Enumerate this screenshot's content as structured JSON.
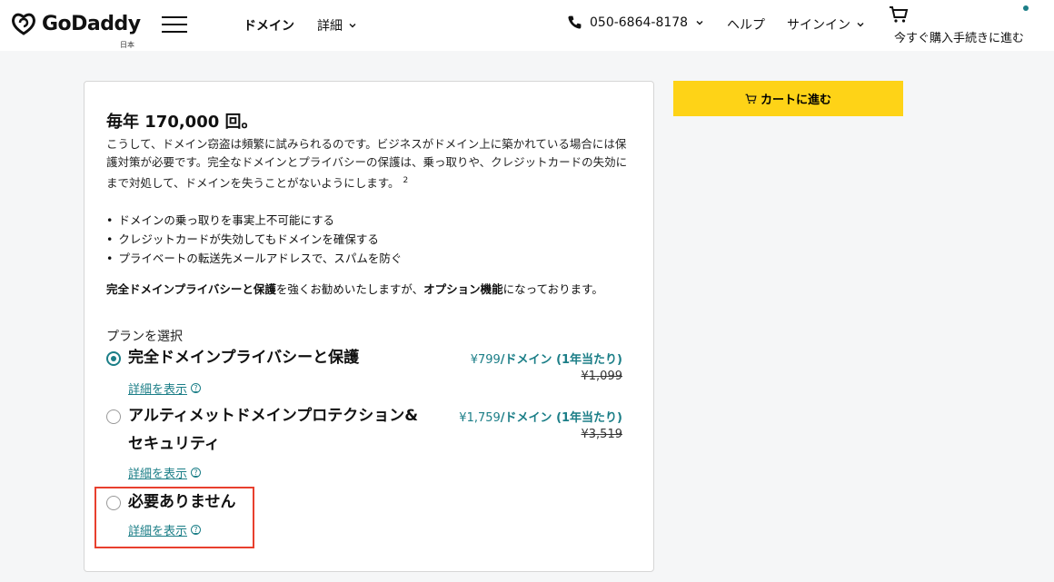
{
  "header": {
    "logo_text": "GoDaddy",
    "region": "日本",
    "nav_domain": "ドメイン",
    "nav_detail": "詳細",
    "phone": "050-6864-8178",
    "help": "ヘルプ",
    "signin": "サインイン",
    "cart_label": "今すぐ購入手続きに進む",
    "accent_color": "#1b7e87"
  },
  "main": {
    "title": "毎年 170,000 回。",
    "description": "こうして、ドメイン窃盗は頻繁に試みられるのです。ビジネスがドメイン上に築かれている場合には保護対策が必要です。完全なドメインとプライバシーの保護は、乗っ取りや、クレジットカードの失効にまで対処して、ドメインを失うことがないようにします。",
    "footnote": "2",
    "bullets": [
      "ドメインの乗っ取りを事実上不可能にする",
      "クレジットカードが失効してもドメインを確保する",
      "プライベートの転送先メールアドレスで、スパムを防ぐ"
    ],
    "recommend_bold1": "完全ドメインプライバシーと保護",
    "recommend_mid": "を強くお勧めいたしますが、",
    "recommend_bold2": "オプション機能",
    "recommend_end": "になっております。",
    "plan_heading": "プランを選択",
    "options": [
      {
        "name": "完全ドメインプライバシーと保護",
        "price": "¥799",
        "price_suffix": "/ドメイン (1年当たり)",
        "old_price": "¥1,099",
        "link": "詳細を表示",
        "selected": true
      },
      {
        "name": "アルティメットドメインプロテクション&セキュリティ",
        "price": "¥1,759",
        "price_suffix": "/ドメイン (1年当たり)",
        "old_price": "¥3,519",
        "link": "詳細を表示",
        "selected": false
      },
      {
        "name": "必要ありません",
        "link": "詳細を表示",
        "selected": false
      }
    ]
  },
  "sidebar": {
    "cart_button": "カートに進む",
    "button_color": "#fed317"
  },
  "highlight_color": "#e8402e"
}
